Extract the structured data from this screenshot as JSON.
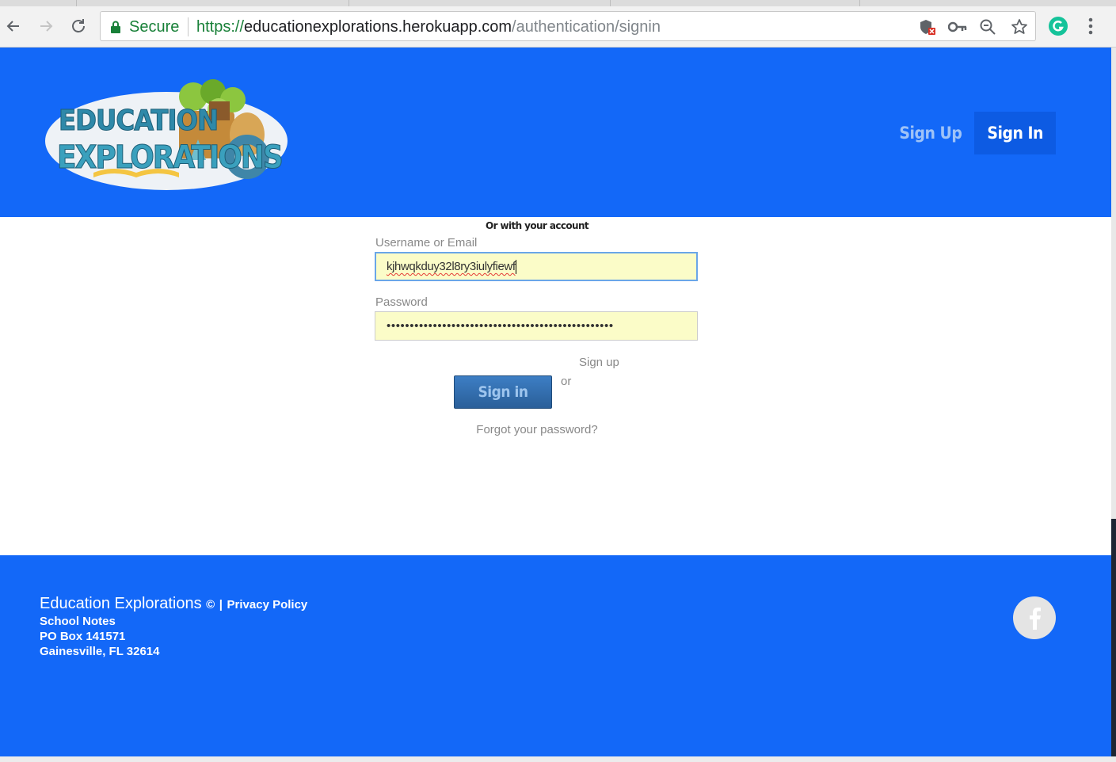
{
  "browser": {
    "secure_label": "Secure",
    "url": {
      "scheme": "https://",
      "host": "educationexplorations.herokuapp.com",
      "path": "/authentication/signin"
    },
    "icons": [
      "back-icon",
      "forward-icon",
      "reload-icon",
      "lock-icon",
      "blocked-shield-icon",
      "key-icon",
      "zoom-icon",
      "bookmark-star-icon",
      "grammarly-icon",
      "menu-dots-icon"
    ],
    "accent_secure": "#188038"
  },
  "header": {
    "logo_alt": "Education Explorations",
    "logo_text": {
      "line1": "EDUCATION",
      "line2": "EXPLORATIONS"
    },
    "nav": {
      "signup_label": "Sign Up",
      "signin_label": "Sign In"
    },
    "background": "#1368f8"
  },
  "form": {
    "heading": "Or with your account",
    "username": {
      "label": "Username or Email",
      "value": "kjhwqkduy32l8ry3iulyfiewf"
    },
    "password": {
      "label": "Password",
      "value": "•••••••••••••••••••••••••••••••••••••••••••••••••"
    },
    "signin_button": "Sign in",
    "or_text": "or",
    "signup_link": "Sign up",
    "forgot_link": "Forgot your password?"
  },
  "footer": {
    "brand": "Education Explorations",
    "copyright_symbol": "©",
    "separator": "|",
    "privacy_link": "Privacy Policy",
    "address": [
      "School Notes",
      "PO Box 141571",
      "Gainesville, FL 32614"
    ],
    "social_icon": "facebook-icon"
  }
}
